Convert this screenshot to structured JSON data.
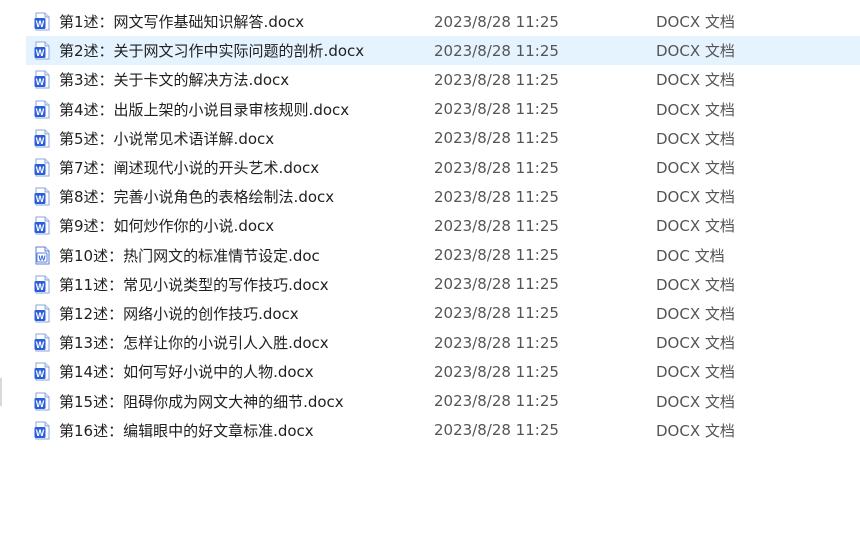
{
  "files": [
    {
      "name": "第1述：网文写作基础知识解答.docx",
      "date": "2023/8/28 11:25",
      "type": "DOCX 文档",
      "icon": "word-docx-icon",
      "selected": false
    },
    {
      "name": "第2述：关于网文习作中实际问题的剖析.docx",
      "date": "2023/8/28 11:25",
      "type": "DOCX 文档",
      "icon": "word-docx-icon",
      "selected": true
    },
    {
      "name": "第3述：关于卡文的解决方法.docx",
      "date": "2023/8/28 11:25",
      "type": "DOCX 文档",
      "icon": "word-docx-icon",
      "selected": false
    },
    {
      "name": "第4述：出版上架的小说目录审核规则.docx",
      "date": "2023/8/28 11:25",
      "type": "DOCX 文档",
      "icon": "word-docx-icon",
      "selected": false
    },
    {
      "name": "第5述：小说常见术语详解.docx",
      "date": "2023/8/28 11:25",
      "type": "DOCX 文档",
      "icon": "word-docx-icon",
      "selected": false
    },
    {
      "name": "第7述：阐述现代小说的开头艺术.docx",
      "date": "2023/8/28 11:25",
      "type": "DOCX 文档",
      "icon": "word-docx-icon",
      "selected": false
    },
    {
      "name": "第8述：完善小说角色的表格绘制法.docx",
      "date": "2023/8/28 11:25",
      "type": "DOCX 文档",
      "icon": "word-docx-icon",
      "selected": false
    },
    {
      "name": "第9述：如何炒作你的小说.docx",
      "date": "2023/8/28 11:25",
      "type": "DOCX 文档",
      "icon": "word-docx-icon",
      "selected": false
    },
    {
      "name": "第10述：热门网文的标准情节设定.doc",
      "date": "2023/8/28 11:25",
      "type": "DOC 文档",
      "icon": "word-doc-icon",
      "selected": false
    },
    {
      "name": "第11述：常见小说类型的写作技巧.docx",
      "date": "2023/8/28 11:25",
      "type": "DOCX 文档",
      "icon": "word-docx-icon",
      "selected": false
    },
    {
      "name": "第12述：网络小说的创作技巧.docx",
      "date": "2023/8/28 11:25",
      "type": "DOCX 文档",
      "icon": "word-docx-icon",
      "selected": false
    },
    {
      "name": "第13述：怎样让你的小说引人入胜.docx",
      "date": "2023/8/28 11:25",
      "type": "DOCX 文档",
      "icon": "word-docx-icon",
      "selected": false
    },
    {
      "name": "第14述：如何写好小说中的人物.docx",
      "date": "2023/8/28 11:25",
      "type": "DOCX 文档",
      "icon": "word-docx-icon",
      "selected": false
    },
    {
      "name": "第15述：阻碍你成为网文大神的细节.docx",
      "date": "2023/8/28 11:25",
      "type": "DOCX 文档",
      "icon": "word-docx-icon",
      "selected": false
    },
    {
      "name": "第16述：编辑眼中的好文章标准.docx",
      "date": "2023/8/28 11:25",
      "type": "DOCX 文档",
      "icon": "word-docx-icon",
      "selected": false
    }
  ],
  "colors": {
    "selection": "#e5f3ff",
    "word_blue": "#2b5fd9",
    "doc_outline": "#5b7fd6"
  }
}
